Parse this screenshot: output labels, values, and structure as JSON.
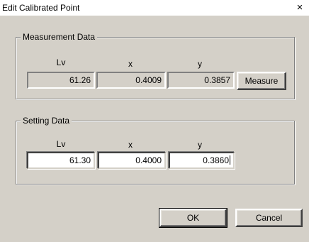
{
  "window": {
    "title": "Edit Calibrated Point",
    "close_glyph": "×"
  },
  "measurement": {
    "group_title": "Measurement Data",
    "headers": {
      "lv": "Lv",
      "x": "x",
      "y": "y"
    },
    "values": {
      "lv": "61.26",
      "x": "0.4009",
      "y": "0.3857"
    },
    "measure_label": "Measure"
  },
  "setting": {
    "group_title": "Setting Data",
    "headers": {
      "lv": "Lv",
      "x": "x",
      "y": "y"
    },
    "values": {
      "lv": "61.30",
      "x": "0.4000",
      "y": "0.3860"
    }
  },
  "buttons": {
    "ok_label": "OK",
    "cancel_label": "Cancel"
  }
}
